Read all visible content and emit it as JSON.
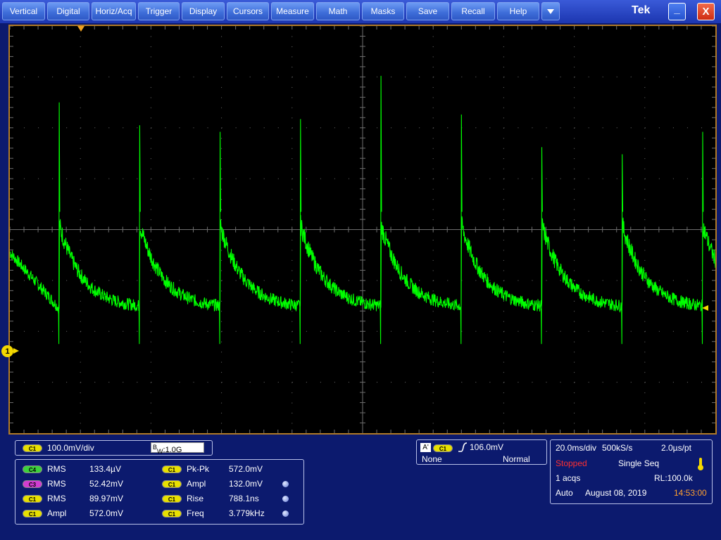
{
  "menu": [
    "Vertical",
    "Digital",
    "Horiz/Acq",
    "Trigger",
    "Display",
    "Cursors",
    "Measure",
    "Math",
    "Masks",
    "Save",
    "Recall",
    "Help"
  ],
  "menu_more_icon": "triangle-down-icon",
  "brand": "Tek",
  "window": {
    "minimize_label": "_",
    "close_label": "X"
  },
  "channel": {
    "marker_label": "1",
    "color": "#00ff00",
    "scale": "100.0mV/div",
    "bandwidth_prefix": "B",
    "bandwidth_sub": "W",
    "bandwidth_value": ":1.0G"
  },
  "measurements": {
    "left": [
      {
        "chip": "C4",
        "chip_color": "#3cd23c",
        "name": "RMS",
        "value": "133.4µV"
      },
      {
        "chip": "C3",
        "chip_color": "#d23cd2",
        "name": "RMS",
        "value": "52.42mV"
      },
      {
        "chip": "C1",
        "chip_color": "#e8e000",
        "name": "RMS",
        "value": "89.97mV"
      },
      {
        "chip": "C1",
        "chip_color": "#e8e000",
        "name": "Ampl",
        "value": "572.0mV"
      }
    ],
    "right": [
      {
        "chip": "C1",
        "chip_color": "#e8e000",
        "name": "Pk-Pk",
        "value": "572.0mV"
      },
      {
        "chip": "C1",
        "chip_color": "#e8e000",
        "name": "Ampl",
        "value": "132.0mV"
      },
      {
        "chip": "C1",
        "chip_color": "#e8e000",
        "name": "Rise",
        "value": "788.1ns"
      },
      {
        "chip": "C1",
        "chip_color": "#e8e000",
        "name": "Freq",
        "value": "3.779kHz"
      }
    ]
  },
  "trigger": {
    "source_tag": "A'",
    "chip": "C1",
    "level": "106.0mV",
    "coupling": "None",
    "mode": "Normal"
  },
  "acquisition": {
    "timebase": "20.0ms/div",
    "sample_rate": "500kS/s",
    "resolution": "2.0µs/pt",
    "status": "Stopped",
    "status_color": "#ff3030",
    "seq_mode": "Single Seq",
    "acqs": "1 acqs",
    "record_length": "RL:100.0k",
    "trigger_mode": "Auto",
    "date": "August 08, 2019",
    "time": "14:53:00",
    "time_color": "#ffa030"
  },
  "waveform": {
    "period_div": 1.14,
    "first_spike_div": 0.7,
    "peak_heights_div": [
      2.5,
      2.05,
      1.92,
      2.17,
      3.02,
      2.26,
      1.62,
      1.48,
      1.92
    ],
    "baseline_div": -1.55,
    "start_level_div": -0.45,
    "dip_div": -2.25
  }
}
